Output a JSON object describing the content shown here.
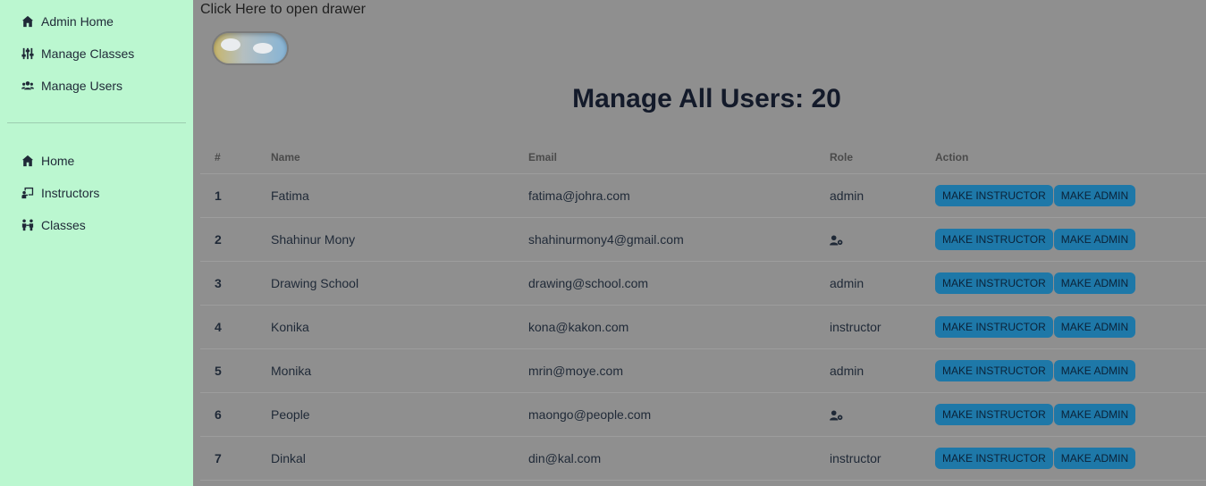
{
  "sidebar": {
    "admin_items": [
      {
        "label": "Admin Home",
        "icon": "home-icon"
      },
      {
        "label": "Manage Classes",
        "icon": "sliders-icon"
      },
      {
        "label": "Manage Users",
        "icon": "users-icon"
      }
    ],
    "general_items": [
      {
        "label": "Home",
        "icon": "home-icon"
      },
      {
        "label": "Instructors",
        "icon": "chalkboard-teacher-icon"
      },
      {
        "label": "Classes",
        "icon": "people-icon"
      }
    ]
  },
  "main": {
    "drawer_text": "Click Here to open drawer",
    "title": "Manage All Users: 20",
    "table": {
      "headers": [
        "#",
        "Name",
        "Email",
        "Role",
        "Action"
      ],
      "rows": [
        {
          "num": "1",
          "name": "Fatima",
          "email": "fatima@johra.com",
          "role": "admin"
        },
        {
          "num": "2",
          "name": "Shahinur Mony",
          "email": "shahinurmony4@gmail.com",
          "role": ""
        },
        {
          "num": "3",
          "name": "Drawing School",
          "email": "drawing@school.com",
          "role": "admin"
        },
        {
          "num": "4",
          "name": "Konika",
          "email": "kona@kakon.com",
          "role": "instructor"
        },
        {
          "num": "5",
          "name": "Monika",
          "email": "mrin@moye.com",
          "role": "admin"
        },
        {
          "num": "6",
          "name": "People",
          "email": "maongo@people.com",
          "role": ""
        },
        {
          "num": "7",
          "name": "Dinkal",
          "email": "din@kal.com",
          "role": "instructor"
        }
      ],
      "make_instructor_label": "MAKE INSTRUCTOR",
      "make_admin_label": "MAKE ADMIN"
    }
  },
  "colors": {
    "sidebar_bg": "#bbf7d0",
    "overlay_bg": "#8f8f8f",
    "button_bg": "#1e78a8"
  }
}
